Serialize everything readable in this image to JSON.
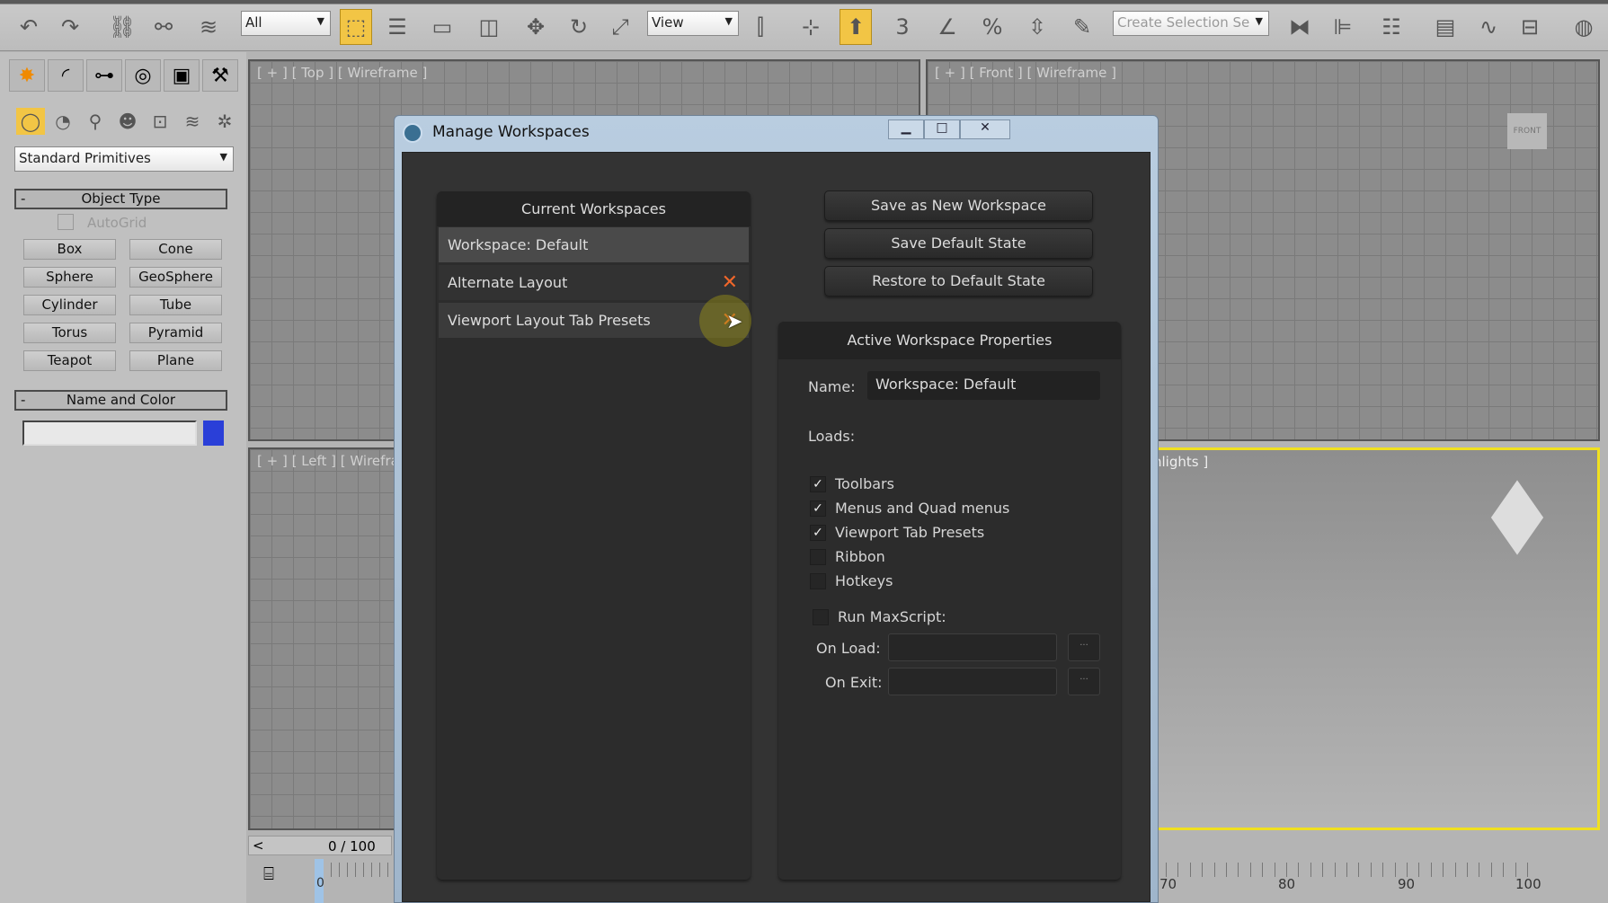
{
  "toolbar": {
    "icons": [
      "undo-icon",
      "redo-icon",
      "link-icon",
      "unlink-icon",
      "bind-space-warp-icon",
      "select-object-icon",
      "select-by-name-icon",
      "rect-selection-region-icon",
      "window-crossing-icon",
      "move-icon",
      "rotate-icon",
      "scale-icon",
      "use-pivot-center-icon",
      "manipulate-icon",
      "keyboard-shortcut-override-icon",
      "snaps-toggle-icon",
      "angle-snap-icon",
      "percent-snap-icon",
      "spinner-snap-icon",
      "edit-named-selection-icon",
      "mirror-icon",
      "align-icon",
      "layer-explorer-icon",
      "scene-explorer-icon",
      "curve-editor-icon",
      "schematic-view-icon",
      "render-setup-icon"
    ],
    "selection_filter": "All",
    "reference_coord": "View",
    "named_selection_placeholder": "Create Selection Se"
  },
  "command_panel": {
    "tabs": [
      "create-tab",
      "modify-tab",
      "hierarchy-tab",
      "motion-tab",
      "display-tab",
      "utilities-tab"
    ],
    "categories": [
      "geometry",
      "shapes",
      "lights",
      "cameras",
      "helpers",
      "space-warps",
      "systems"
    ],
    "primitive_type": "Standard Primitives",
    "object_type": {
      "title": "Object Type",
      "collapse": "-",
      "autogrid": "AutoGrid",
      "buttons": [
        "Box",
        "Cone",
        "Sphere",
        "GeoSphere",
        "Cylinder",
        "Tube",
        "Torus",
        "Pyramid",
        "Teapot",
        "Plane"
      ]
    },
    "name_and_color": {
      "title": "Name and Color",
      "collapse": "-",
      "name_value": "",
      "color": "#2a3fd8"
    }
  },
  "viewports": {
    "top": "[ + ] [ Top ] [ Wireframe ]",
    "front": "[ + ] [ Front ] [ Wireframe ]",
    "left": "[ + ] [ Left ] [ Wirefram",
    "perspective": "hlights ]",
    "viewcube_front": "FRONT"
  },
  "timeline": {
    "slider": "0 / 100",
    "prev": "<",
    "ticks": [
      "0",
      "70",
      "80",
      "90",
      "100"
    ]
  },
  "dialog": {
    "title": "Manage Workspaces",
    "current_header": "Current Workspaces",
    "workspaces": [
      {
        "label": "Workspace: Default",
        "deletable": false
      },
      {
        "label": "Alternate Layout",
        "deletable": true
      },
      {
        "label": "Viewport Layout Tab Presets",
        "deletable": true
      }
    ],
    "delete_glyph": "✕",
    "buttons": [
      "Save as New Workspace",
      "Save Default State",
      "Restore to Default State"
    ],
    "props_header": "Active Workspace Properties",
    "name_label": "Name:",
    "name_value": "Workspace: Default",
    "loads_label": "Loads:",
    "loads": [
      {
        "label": "Toolbars",
        "checked": true
      },
      {
        "label": "Menus and Quad menus",
        "checked": true
      },
      {
        "label": "Viewport Tab Presets",
        "checked": true
      },
      {
        "label": "Ribbon",
        "checked": false
      },
      {
        "label": "Hotkeys",
        "checked": false
      }
    ],
    "run_maxscript": {
      "label": "Run MaxScript:",
      "checked": false
    },
    "on_load": {
      "label": "On Load:",
      "value": "",
      "browse": "..."
    },
    "on_exit": {
      "label": "On Exit:",
      "value": "",
      "browse": "..."
    },
    "accent": "#f0662a"
  }
}
